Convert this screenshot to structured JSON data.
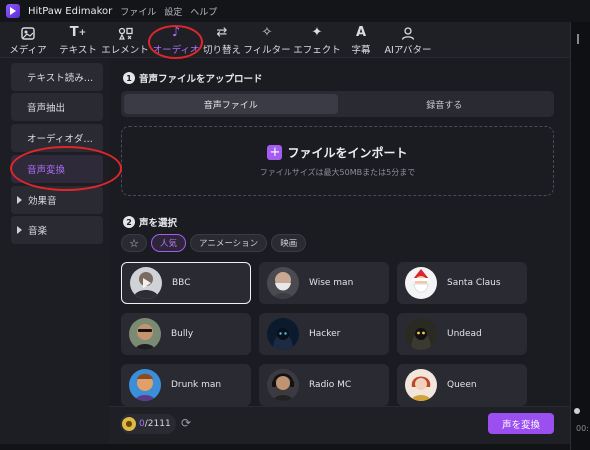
{
  "app": {
    "title": "HitPaw Edimakor",
    "menu": [
      "ファイル",
      "設定",
      "ヘルプ"
    ]
  },
  "toolbar": {
    "tools": [
      {
        "label": "メディア",
        "icon": "media-icon"
      },
      {
        "label": "テキスト",
        "icon": "text-icon"
      },
      {
        "label": "エレメント",
        "icon": "element-icon"
      },
      {
        "label": "オーディオ",
        "icon": "music-note-icon",
        "active": true
      },
      {
        "label": "切り替え",
        "icon": "transition-icon"
      },
      {
        "label": "フィルター",
        "icon": "filter-icon"
      },
      {
        "label": "エフェクト",
        "icon": "effect-sparkle-icon"
      },
      {
        "label": "字幕",
        "icon": "subtitle-icon"
      },
      {
        "label": "AIアバター",
        "icon": "ai-avatar-icon"
      }
    ]
  },
  "sidebar": {
    "items": [
      {
        "label": "テキスト読み…"
      },
      {
        "label": "音声抽出"
      },
      {
        "label": "オーディオダ…"
      },
      {
        "label": "音声変換",
        "active": true
      },
      {
        "label": "効果音"
      },
      {
        "label": "音楽"
      }
    ]
  },
  "upload": {
    "step": "1",
    "title": "音声ファイルをアップロード",
    "tabs": [
      "音声ファイル",
      "録音する"
    ],
    "import_label": "ファイルをインポート",
    "hint": "ファイルサイズは最大50MBまたは5分まで"
  },
  "voices": {
    "step": "2",
    "title": "声を選択",
    "filters": [
      "人気",
      "アニメーション",
      "映画"
    ],
    "active_filter": "人気",
    "cards": [
      {
        "name": "BBC",
        "selected": true
      },
      {
        "name": "Wise man"
      },
      {
        "name": "Santa Claus"
      },
      {
        "name": "Bully"
      },
      {
        "name": "Hacker"
      },
      {
        "name": "Undead"
      },
      {
        "name": "Drunk man"
      },
      {
        "name": "Radio MC"
      },
      {
        "name": "Queen"
      }
    ]
  },
  "footer": {
    "credits_used": "0",
    "credits_total": "/2111",
    "convert_label": "声を変換",
    "time": "00:"
  },
  "colors": {
    "accent": "#a55cf0",
    "annotation": "#e0262b"
  }
}
